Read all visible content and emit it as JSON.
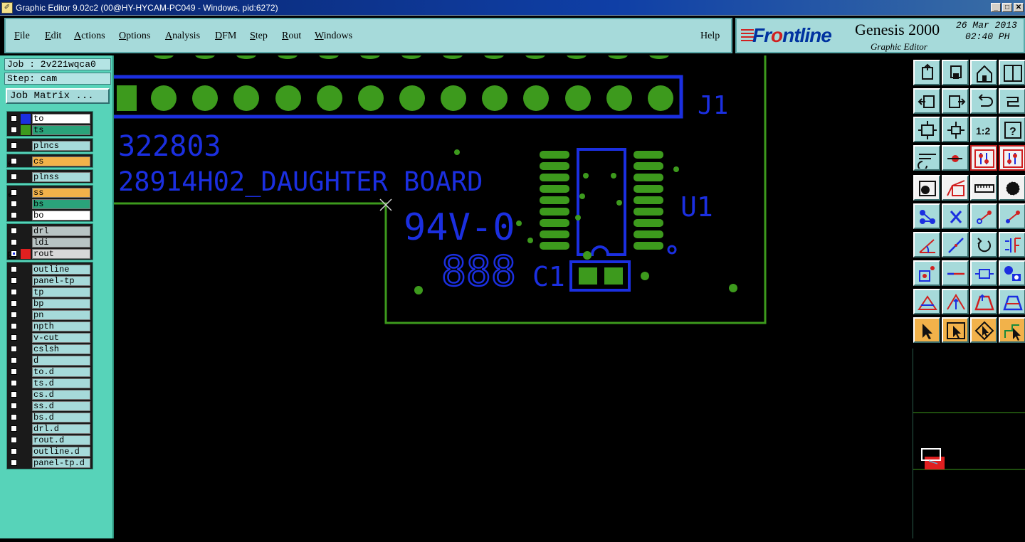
{
  "window": {
    "title": "Graphic Editor 9.02c2 (00@HY-HYCAM-PC049 - Windows, pid:6272)",
    "app_icon": "editor-app-icon",
    "controls": [
      "_",
      "□",
      "✕"
    ]
  },
  "menu": {
    "items": [
      {
        "key": "F",
        "rest": "ile"
      },
      {
        "key": "E",
        "rest": "dit"
      },
      {
        "key": "A",
        "rest": "ctions"
      },
      {
        "key": "O",
        "rest": "ptions"
      },
      {
        "key": "A",
        "rest": "nalysis"
      },
      {
        "key": "D",
        "rest": "FM"
      },
      {
        "key": "S",
        "rest": "tep"
      },
      {
        "key": "R",
        "rest": "out"
      },
      {
        "key": "W",
        "rest": "indows"
      }
    ],
    "help": "Help"
  },
  "brand": {
    "logo_prefix": "Fr",
    "logo_o": "o",
    "logo_suffix": "ntline",
    "product": "Genesis 2000",
    "subtitle": "Graphic Editor",
    "date": "26 Mar 2013",
    "time": "02:40 PH"
  },
  "job": {
    "job_line": "Job : 2v221wqca0",
    "step_line": "Step: cam",
    "matrix_button": "Job Matrix ..."
  },
  "layers": {
    "groups": [
      [
        {
          "name": "to",
          "swatch": "#1b2fe0",
          "bg": "#ffffff",
          "checked": false
        },
        {
          "name": "ts",
          "swatch": "#3d9a1d",
          "bg": "#2aa37a",
          "checked": false
        }
      ],
      [
        {
          "name": "plncs",
          "swatch": "",
          "bg": "#a6dada",
          "checked": false
        }
      ],
      [
        {
          "name": "cs",
          "swatch": "",
          "bg": "#f2b24a",
          "checked": false,
          "mark": "✐"
        }
      ],
      [
        {
          "name": "plnss",
          "swatch": "",
          "bg": "#a6dada",
          "checked": false
        }
      ],
      [
        {
          "name": "ss",
          "swatch": "",
          "bg": "#f2b24a",
          "checked": false,
          "mark": "✐"
        },
        {
          "name": "bs",
          "swatch": "",
          "bg": "#2aa37a",
          "checked": false
        },
        {
          "name": "bo",
          "swatch": "",
          "bg": "#ffffff",
          "checked": false
        }
      ],
      [
        {
          "name": "drl",
          "swatch": "",
          "bg": "#b8c4c4",
          "checked": false
        },
        {
          "name": "ldi",
          "swatch": "",
          "bg": "#b8c4c4",
          "checked": false
        },
        {
          "name": "rout",
          "swatch": "#e02020",
          "bg": "#d8d8d8",
          "checked": true,
          "mark": "⊞"
        }
      ],
      [
        {
          "name": "outline",
          "swatch": "",
          "bg": "#a6dada",
          "checked": false
        },
        {
          "name": "panel-tp",
          "swatch": "",
          "bg": "#a6dada",
          "checked": false
        },
        {
          "name": "tp",
          "swatch": "",
          "bg": "#a6dada",
          "checked": false
        },
        {
          "name": "bp",
          "swatch": "",
          "bg": "#a6dada",
          "checked": false
        },
        {
          "name": "pn",
          "swatch": "",
          "bg": "#a6dada",
          "checked": false
        },
        {
          "name": "npth",
          "swatch": "",
          "bg": "#a6dada",
          "checked": false
        },
        {
          "name": "v-cut",
          "swatch": "",
          "bg": "#a6dada",
          "checked": false
        },
        {
          "name": "cslsh",
          "swatch": "",
          "bg": "#a6dada",
          "checked": false
        },
        {
          "name": "d",
          "swatch": "",
          "bg": "#a6dada",
          "checked": false
        },
        {
          "name": "to.d",
          "swatch": "",
          "bg": "#a6dada",
          "checked": false
        },
        {
          "name": "ts.d",
          "swatch": "",
          "bg": "#a6dada",
          "checked": false
        },
        {
          "name": "cs.d",
          "swatch": "",
          "bg": "#a6dada",
          "checked": false
        },
        {
          "name": "ss.d",
          "swatch": "",
          "bg": "#a6dada",
          "checked": false
        },
        {
          "name": "bs.d",
          "swatch": "",
          "bg": "#a6dada",
          "checked": false
        },
        {
          "name": "drl.d",
          "swatch": "",
          "bg": "#a6dada",
          "checked": false
        },
        {
          "name": "rout.d",
          "swatch": "",
          "bg": "#a6dada",
          "checked": false
        },
        {
          "name": "outline.d",
          "swatch": "",
          "bg": "#a6dada",
          "checked": false
        },
        {
          "name": "panel-tp.d",
          "swatch": "",
          "bg": "#a6dada",
          "checked": false
        }
      ]
    ]
  },
  "board": {
    "part_number": "322803",
    "board_name": "28914H02_DAUGHTER BOARD",
    "rating": "94V-0",
    "date_code": "888",
    "connector": "J1",
    "chip": "U1",
    "capacitor": "C1"
  },
  "toolbar": {
    "ratio_label": "1:2",
    "help_label": "?",
    "icons": [
      "zoom-home-icon",
      "zoom-back-icon",
      "home-icon",
      "window-icon",
      "pan-left-icon",
      "pan-right-icon",
      "undo-icon",
      "snap-icon",
      "fit-screen-icon",
      "zoom-center-icon",
      "ratio-icon",
      "help-icon",
      "measure-tool-icon",
      "drill-icon",
      "layer-red-icon",
      "layer-red-alt-icon",
      "pad-select-icon",
      "area-select-icon",
      "ruler-icon",
      "circle-pad-icon",
      "connect-icon",
      "cross-icon",
      "line-point-icon",
      "line-red-icon",
      "angle-icon",
      "diagonal-line-icon",
      "rotate-icon",
      "mirror-icon",
      "pad-add-icon",
      "segment-icon",
      "stretch-icon",
      "shapes-icon",
      "arc-icon",
      "arrow-up-icon",
      "trapezoid-icon",
      "trapezoid-alt-icon",
      "pointer-icon",
      "select-box-icon",
      "select-rotate-icon",
      "route-select-icon"
    ]
  }
}
